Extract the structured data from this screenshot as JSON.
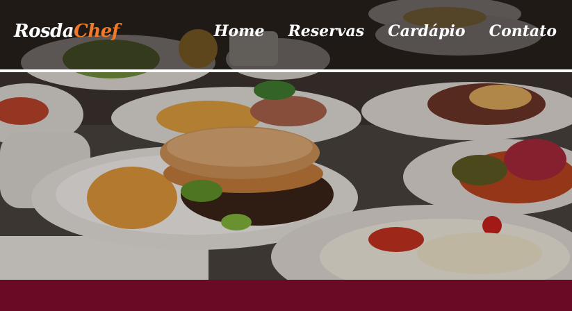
{
  "brand": {
    "part1": "Rosda",
    "part2": "Chef",
    "accent_color": "#f07a2a"
  },
  "nav": {
    "items": [
      "Home",
      "Reservas",
      "Cardápio",
      "Contato"
    ]
  },
  "hero": {
    "image_description_icon": "food-plates-image"
  },
  "theme": {
    "footer_color": "#6b0a24",
    "divider_color": "#ffffff"
  }
}
